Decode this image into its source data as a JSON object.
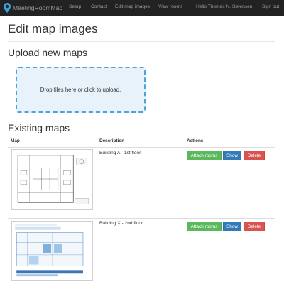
{
  "navbar": {
    "brand": "MeetingRoomMap",
    "items": [
      "Setup",
      "Contact",
      "Edit map images",
      "View rooms"
    ],
    "user_greeting": "Hello Thomas N. Sørensen!",
    "sign_out": "Sign out"
  },
  "page": {
    "title": "Edit map images",
    "upload_heading": "Upload new maps",
    "dropzone_text": "Drop files here or click to upload.",
    "existing_heading": "Existing maps"
  },
  "table": {
    "headers": [
      "Map",
      "Description",
      "Actions"
    ],
    "rows": [
      {
        "description": "Building A - 1st floor",
        "actions": {
          "attach": "Attach rooms",
          "show": "Show",
          "delete": "Delete"
        }
      },
      {
        "description": "Building X - 2nd floor",
        "actions": {
          "attach": "Attach rooms",
          "show": "Show",
          "delete": "Delete"
        }
      }
    ]
  },
  "colors": {
    "navbar_bg": "#222222",
    "dropzone_border": "#4aa3df",
    "dropzone_bg": "#e8f2fb",
    "success": "#5cb85c",
    "primary": "#337ab7",
    "danger": "#d9534f"
  }
}
